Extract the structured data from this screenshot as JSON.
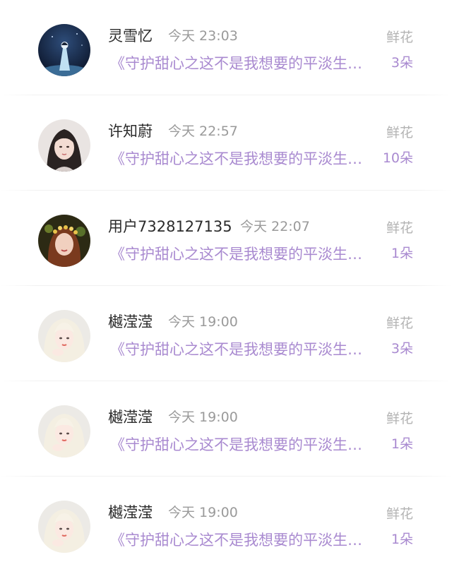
{
  "list": {
    "items": [
      {
        "name": "灵雪忆",
        "time": "今天 23:03",
        "gift_label": "鲜花",
        "desc": "《守护甜心之这不是我想要的平淡生活》",
        "count": "3朵",
        "avatar": "night-scene"
      },
      {
        "name": "许知蔚",
        "time": "今天 22:57",
        "gift_label": "鲜花",
        "desc": "《守护甜心之这不是我想要的平淡生活》",
        "count": "10朵",
        "avatar": "dark-hair-girl"
      },
      {
        "name": "用户7328127135",
        "time": "今天 22:07",
        "gift_label": "鲜花",
        "desc": "《守护甜心之这不是我想要的平淡生活》",
        "count": "1朵",
        "avatar": "flower-crown-girl"
      },
      {
        "name": "樾滢滢",
        "time": "今天 19:00",
        "gift_label": "鲜花",
        "desc": "《守护甜心之这不是我想要的平淡生活》",
        "count": "3朵",
        "avatar": "blonde-girl"
      },
      {
        "name": "樾滢滢",
        "time": "今天 19:00",
        "gift_label": "鲜花",
        "desc": "《守护甜心之这不是我想要的平淡生活》",
        "count": "1朵",
        "avatar": "blonde-girl"
      },
      {
        "name": "樾滢滢",
        "time": "今天 19:00",
        "gift_label": "鲜花",
        "desc": "《守护甜心之这不是我想要的平淡生活》",
        "count": "1朵",
        "avatar": "blonde-girl"
      }
    ]
  },
  "colors": {
    "name": "#2b2b2b",
    "time": "#9a9a9a",
    "gift_label": "#b3b3b3",
    "accent_purple": "#a98ad0"
  }
}
